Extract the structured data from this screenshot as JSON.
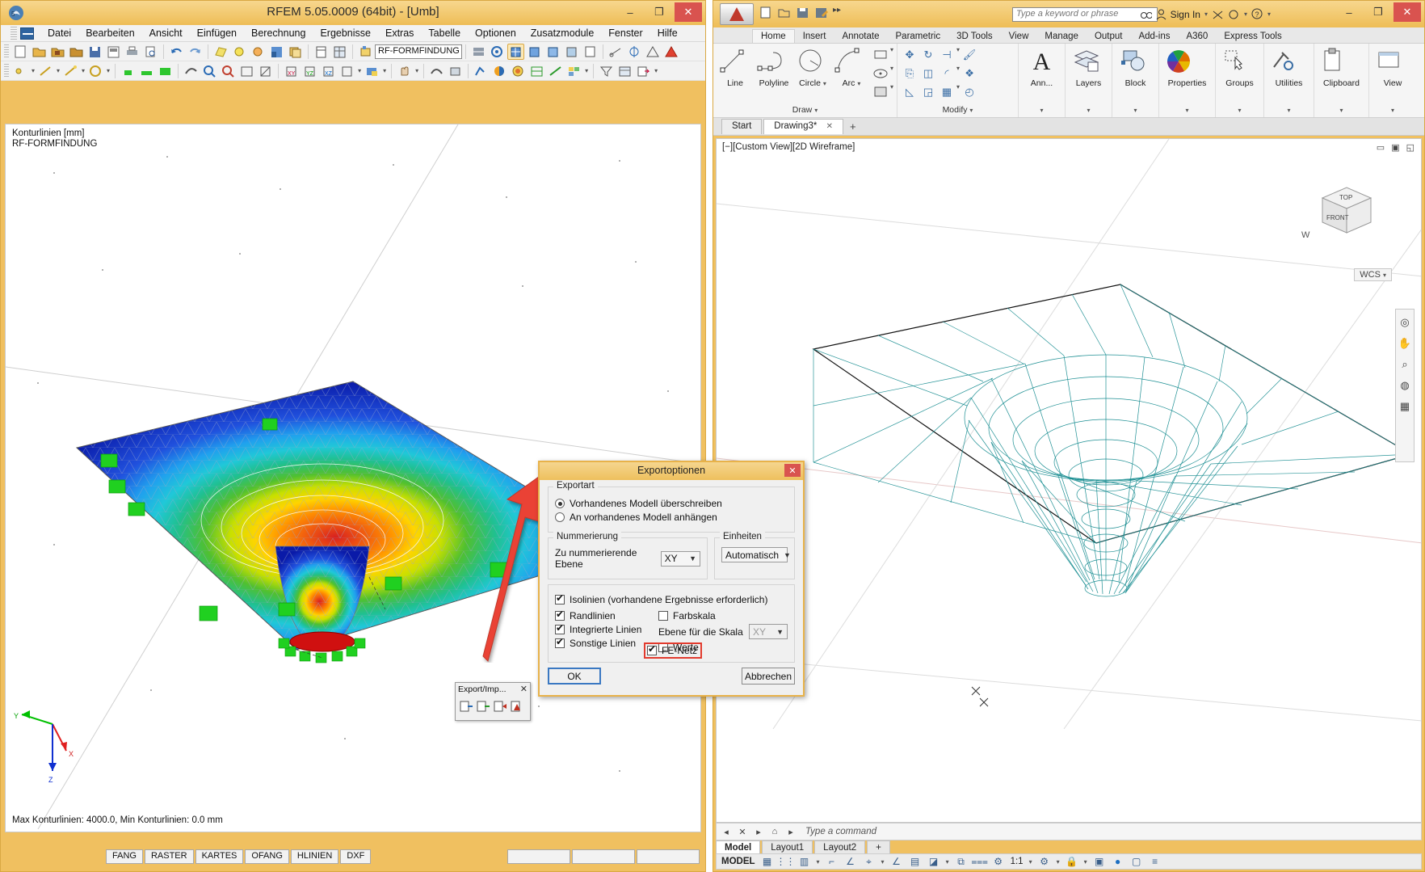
{
  "rfem": {
    "title": "RFEM 5.05.0009 (64bit) - [Umb]",
    "window_buttons": {
      "minimize": "–",
      "maximize": "❐",
      "close": "✕"
    },
    "menu": [
      "Datei",
      "Bearbeiten",
      "Ansicht",
      "Einfügen",
      "Berechnung",
      "Ergebnisse",
      "Extras",
      "Tabelle",
      "Optionen",
      "Zusatzmodule",
      "Fenster",
      "Hilfe"
    ],
    "toolbar_combo_value": "RF-FORMFINDUNG",
    "canvas_label_line1": "Konturlinien [mm]",
    "canvas_label_line2": "RF-FORMFINDUNG",
    "canvas_footer": "Max Konturlinien: 4000.0, Min Konturlinien: 0.0 mm",
    "status_panels": [
      "FANG",
      "RASTER",
      "KARTES",
      "OFANG",
      "HLINIEN",
      "DXF"
    ],
    "axis_labels": {
      "x": "X",
      "y": "Y",
      "z": "Z"
    },
    "export_toolbar": {
      "title": "Export/Imp...",
      "close": "✕"
    }
  },
  "autocad": {
    "document_title": "Drawing3.dwg",
    "search_placeholder": "Type a keyword or phrase",
    "sign_in": "Sign In",
    "window_buttons": {
      "minimize": "–",
      "maximize": "❐",
      "close": "✕"
    },
    "ribbon_tabs": [
      "Home",
      "Insert",
      "Annotate",
      "Parametric",
      "3D Tools",
      "View",
      "Manage",
      "Output",
      "Add-ins",
      "A360",
      "Express Tools"
    ],
    "active_ribbon_tab": "Home",
    "panels": [
      {
        "label": "Draw",
        "buttons": [
          "Line",
          "Polyline",
          "Circle",
          "Arc"
        ]
      },
      {
        "label": "Modify",
        "buttons": []
      },
      {
        "label": "",
        "buttons": [
          "Ann..."
        ]
      },
      {
        "label": "",
        "buttons": [
          "Layers"
        ]
      },
      {
        "label": "",
        "buttons": [
          "Block"
        ]
      },
      {
        "label": "",
        "buttons": [
          "Properties"
        ]
      },
      {
        "label": "",
        "buttons": [
          "Groups"
        ]
      },
      {
        "label": "",
        "buttons": [
          "Utilities"
        ]
      },
      {
        "label": "",
        "buttons": [
          "Clipboard"
        ]
      },
      {
        "label": "",
        "buttons": [
          "View"
        ]
      }
    ],
    "file_tabs": [
      {
        "label": "Start",
        "active": false
      },
      {
        "label": "Drawing3*",
        "active": true,
        "close": "✕"
      }
    ],
    "new_tab": "+",
    "viewport_label": "[−][Custom View][2D Wireframe]",
    "viewcube": {
      "top": "TOP",
      "front": "FRONT",
      "wcs": "WCS"
    },
    "command_placeholder": "Type a command",
    "layout_tabs": [
      "Model",
      "Layout1",
      "Layout2"
    ],
    "layout_add": "+",
    "status_model_label": "MODEL",
    "status_scale": "1:1"
  },
  "dialog": {
    "title": "Exportoptionen",
    "close_label": "✕",
    "export_group": {
      "legend": "Exportart",
      "options": [
        {
          "label": "Vorhandenes Modell überschreiben",
          "selected": true
        },
        {
          "label": "An vorhandenes Modell anhängen",
          "selected": false
        }
      ]
    },
    "numbering_group": {
      "legend": "Nummerierung",
      "field_label": "Zu nummerierende Ebene",
      "value": "XY"
    },
    "units_group": {
      "legend": "Einheiten",
      "value": "Automatisch"
    },
    "checkboxes": {
      "isolinien": {
        "label": "Isolinien (vorhandene Ergebnisse erforderlich)",
        "checked": true
      },
      "randlinien": {
        "label": "Randlinien",
        "checked": true
      },
      "integrierte": {
        "label": "Integrierte Linien",
        "checked": true
      },
      "sonstige": {
        "label": "Sonstige Linien",
        "checked": true
      },
      "farbskala": {
        "label": "Farbskala",
        "checked": false
      },
      "fenetz": {
        "label": "FE-Netz",
        "checked": true,
        "highlighted": true
      },
      "werte": {
        "label": "Werte",
        "checked": false
      }
    },
    "scale_level": {
      "label": "Ebene für die Skala",
      "value": "XY",
      "disabled": true
    },
    "buttons": {
      "ok": "OK",
      "cancel": "Abbrechen"
    }
  },
  "colors": {
    "window_chrome": "#eec05d",
    "accent_red": "#e23b2e",
    "mesh_cyan": "#1d8f93",
    "close_red": "#d9534f",
    "highlight_blue": "#3a78c2"
  }
}
